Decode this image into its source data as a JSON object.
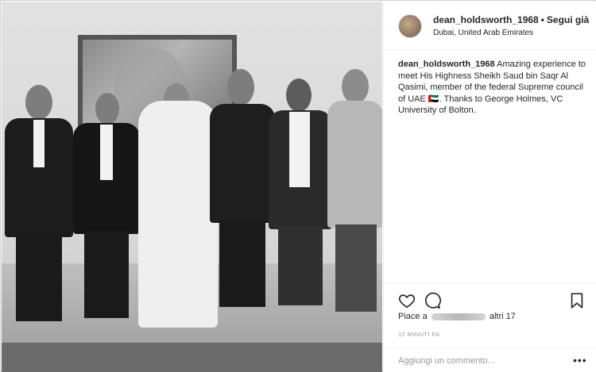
{
  "post": {
    "username": "dean_holdsworth_1968",
    "separator": "•",
    "follow_label": "Segui già",
    "location": "Dubai, United Arab Emirates",
    "caption_user": "dean_holdsworth_1968",
    "caption_text": "Amazing experience to meet His Highness Sheikh Saud bin Saqr Al Qasimi, member of the federal Supreme council of UAE 🇦🇪. Thanks to George Holmes, VC University of Bolton.",
    "likes_prefix": "Piace a",
    "likes_suffix": "altri 17",
    "timestamp": "12 MINUTI FA",
    "comment_placeholder": "Aggiungi un commento...",
    "more_label": "•••"
  },
  "icons": {
    "heart": "heart-icon",
    "comment": "comment-icon",
    "save": "bookmark-icon",
    "more": "more-options-icon"
  },
  "colors": {
    "text": "#262626",
    "muted": "#999999",
    "border": "#efefef"
  }
}
